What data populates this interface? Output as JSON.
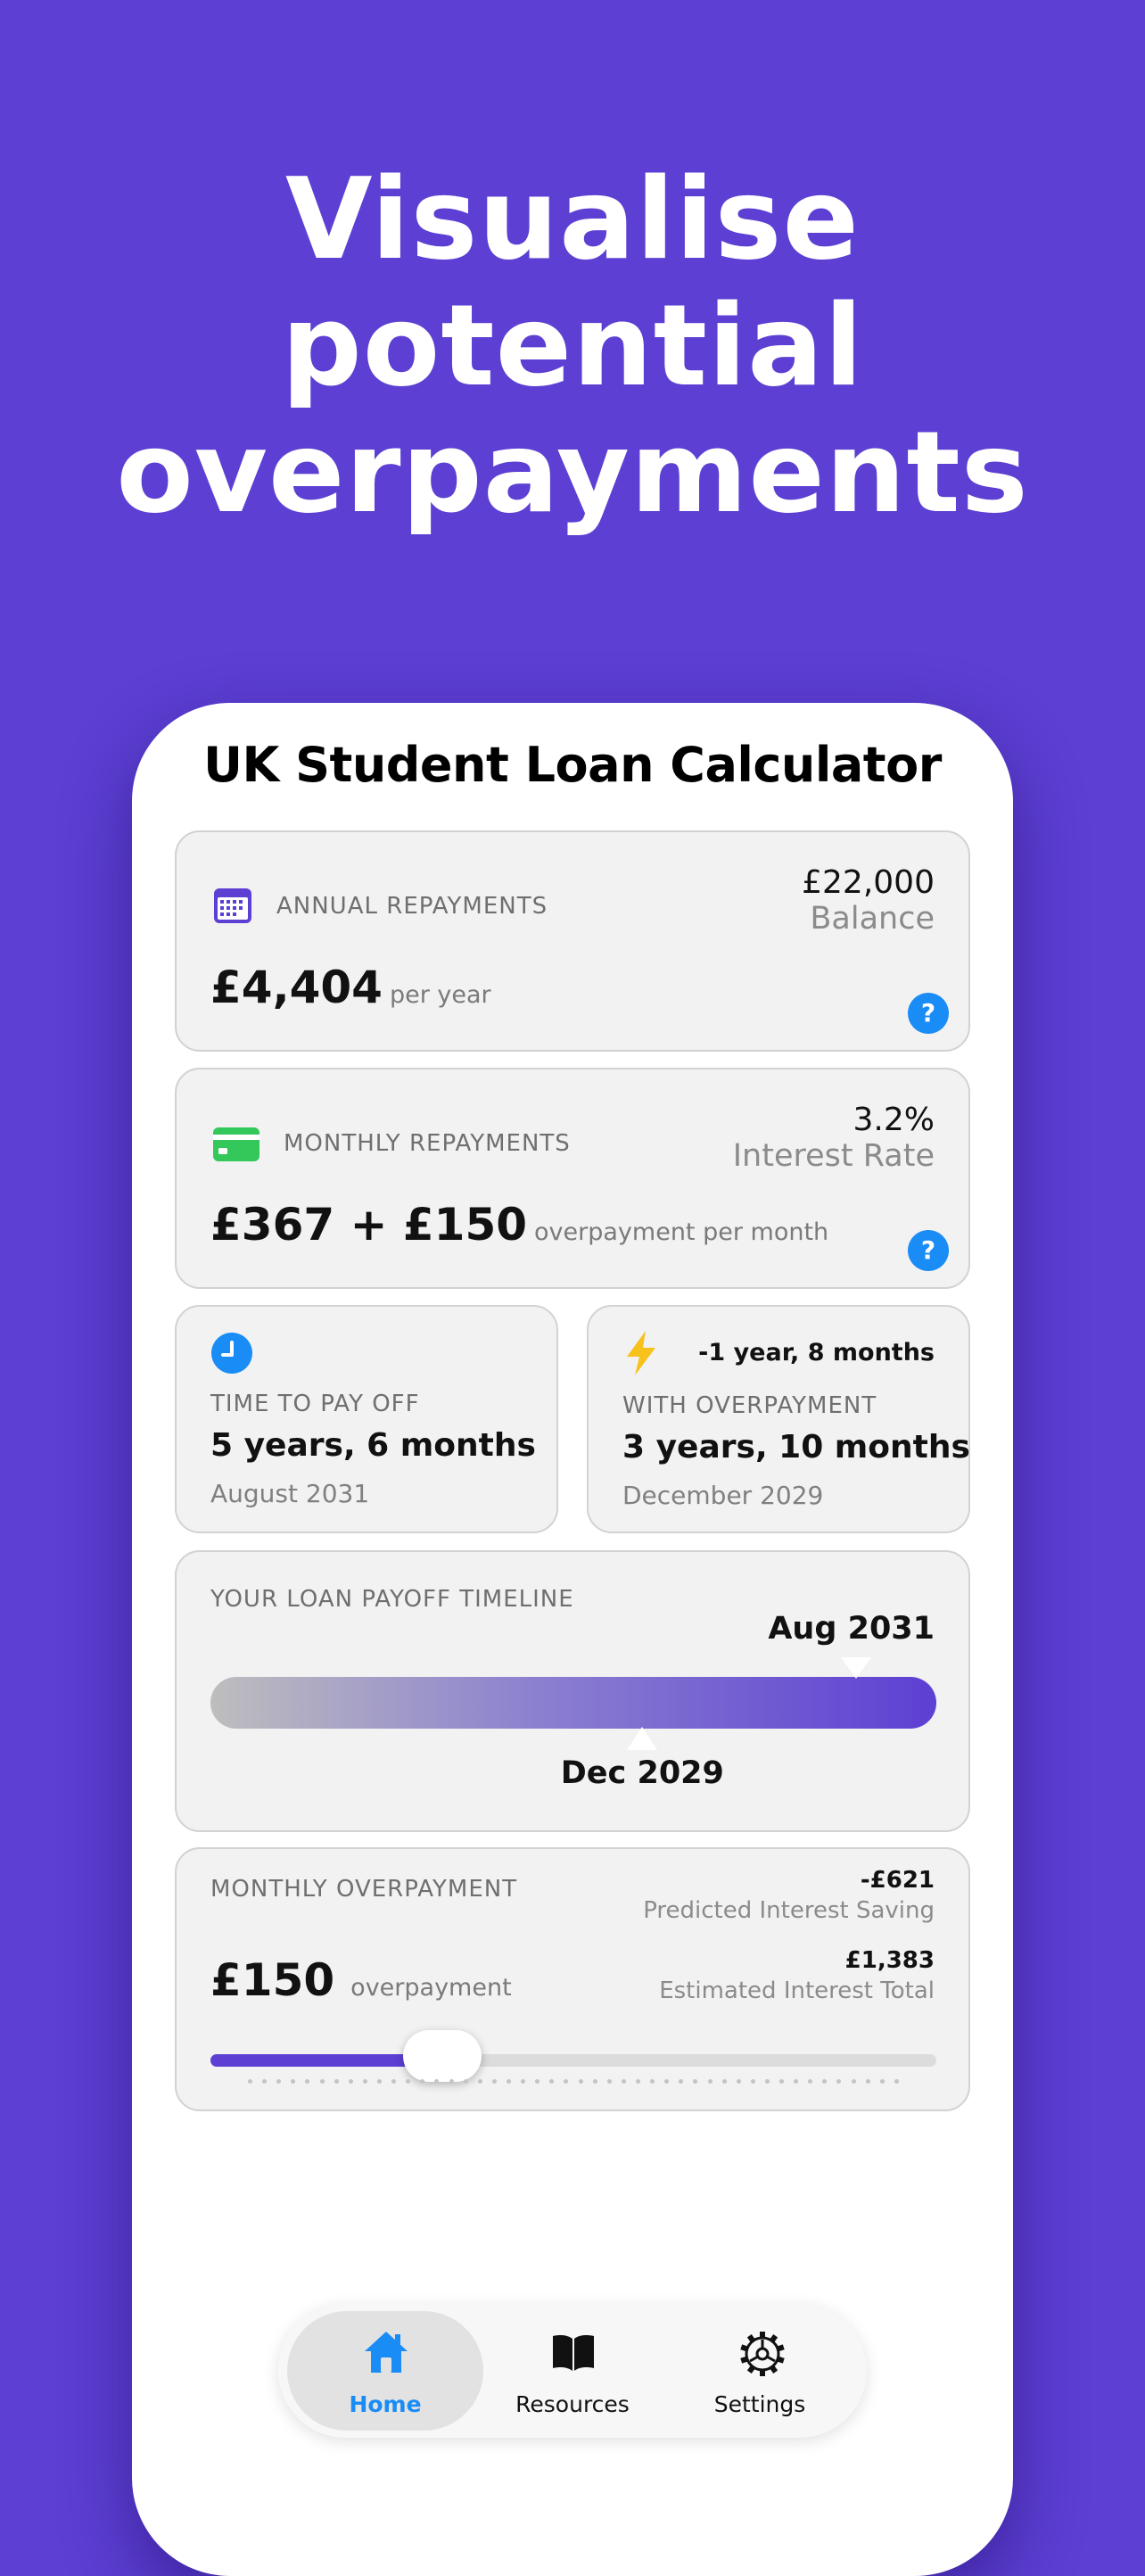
{
  "headline": {
    "line1": "Visualise",
    "line2": "potential",
    "line3": "overpayments"
  },
  "app": {
    "title": "UK Student Loan Calculator"
  },
  "annual": {
    "icon": "calendar-icon",
    "label": "ANNUAL REPAYMENTS",
    "amount": "£4,404",
    "unit": "per year",
    "balance_value": "£22,000",
    "balance_label": "Balance",
    "help": "?"
  },
  "monthly": {
    "icon": "credit-card-icon",
    "label": "MONTHLY REPAYMENTS",
    "amount": "£367 + £150",
    "unit": "overpayment per month",
    "rate_value": "3.2%",
    "rate_label": "Interest Rate",
    "help": "?"
  },
  "payoff": {
    "icon": "clock-icon",
    "label": "TIME TO PAY OFF",
    "duration": "5 years, 6 months",
    "date": "August 2031"
  },
  "overpay_result": {
    "icon": "lightning-icon",
    "delta": "-1 year, 8 months",
    "label": "WITH OVERPAYMENT",
    "duration": "3 years, 10 months",
    "date": "December 2029"
  },
  "timeline": {
    "label": "YOUR LOAN PAYOFF TIMELINE",
    "end_label": "Aug 2031",
    "overpay_label": "Dec 2029",
    "end_marker_fraction": 0.89,
    "overpay_marker_fraction": 0.595
  },
  "overpayment": {
    "label": "MONTHLY OVERPAYMENT",
    "amount": "£150",
    "unit": "overpayment",
    "saving_value": "-£621",
    "saving_label": "Predicted Interest Saving",
    "total_value": "£1,383",
    "total_label": "Estimated Interest Total",
    "slider_fraction": 0.32
  },
  "tabs": [
    {
      "label": "Home",
      "icon": "house-icon",
      "active": true
    },
    {
      "label": "Resources",
      "icon": "book-icon",
      "active": false
    },
    {
      "label": "Settings",
      "icon": "gear-icon",
      "active": false
    }
  ],
  "colors": {
    "background": "#5d3fd3",
    "accent": "#1a8cf5",
    "card": "#f2f2f2"
  }
}
